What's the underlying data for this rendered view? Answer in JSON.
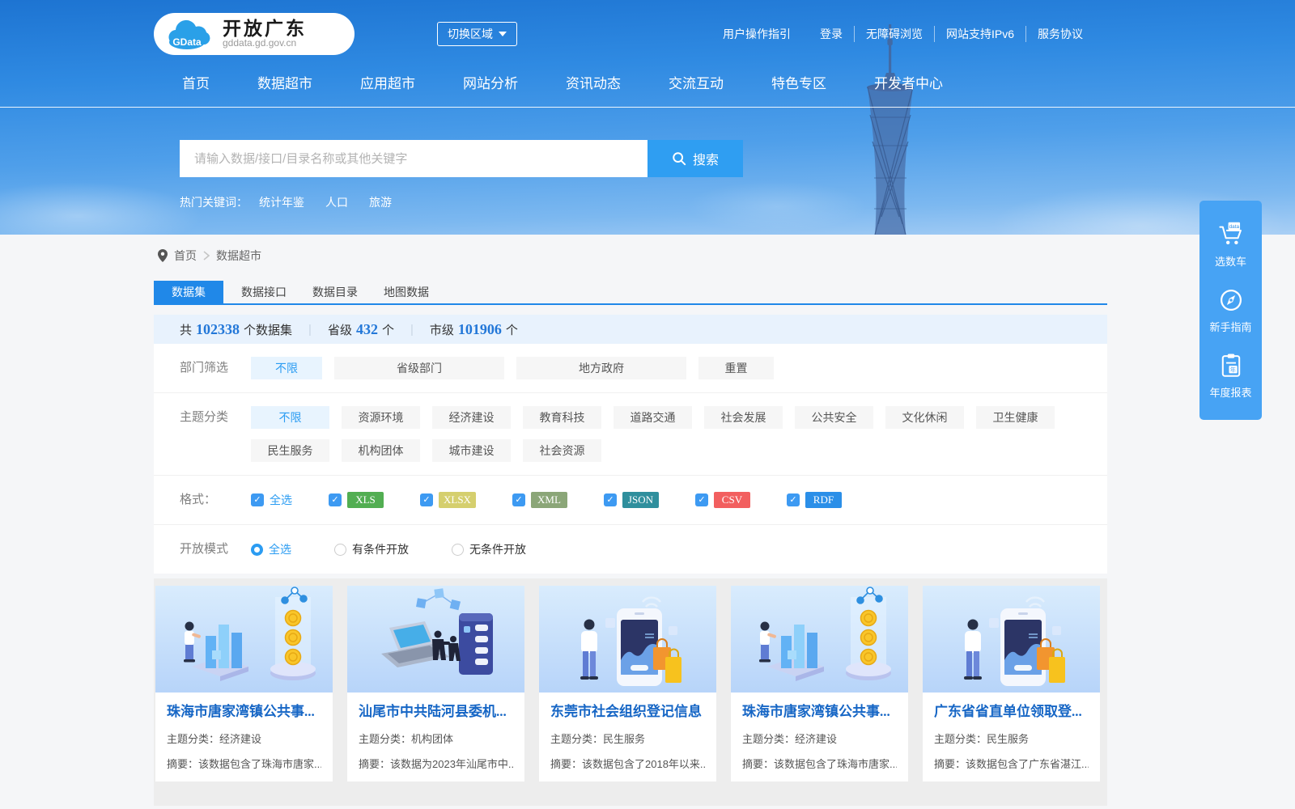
{
  "header": {
    "logo": {
      "badge": "GData",
      "title": "开放广东",
      "domain": "gddata.gd.gov.cn"
    },
    "region_switch_label": "切换区域",
    "top_links": [
      "用户操作指引",
      "登录",
      "无障碍浏览",
      "网站支持IPv6",
      "服务协议"
    ],
    "nav_items": [
      "首页",
      "数据超市",
      "应用超市",
      "网站分析",
      "资讯动态",
      "交流互动",
      "特色专区",
      "开发者中心"
    ]
  },
  "search": {
    "placeholder": "请输入数据/接口/目录名称或其他关键字",
    "button_label": "搜索",
    "hot_label": "热门关键词：",
    "hot_keywords": [
      "统计年鉴",
      "人口",
      "旅游"
    ]
  },
  "side_panel": {
    "items": [
      {
        "icon": "cart-data-icon",
        "label": "选数车"
      },
      {
        "icon": "compass-icon",
        "label": "新手指南"
      },
      {
        "icon": "annual-report-icon",
        "label": "年度报表"
      }
    ]
  },
  "breadcrumb": {
    "home": "首页",
    "current": "数据超市"
  },
  "tabs": [
    "数据集",
    "数据接口",
    "数据目录",
    "地图数据"
  ],
  "stats": {
    "total_prefix": "共",
    "total": "102338",
    "total_suffix": "个数据集",
    "province_label": "省级",
    "province": "432",
    "city_label": "市级",
    "city": "101906",
    "unit": "个"
  },
  "filters": {
    "department": {
      "label": "部门筛选",
      "active": "不限",
      "options": [
        "不限",
        "省级部门",
        "地方政府",
        "重置"
      ]
    },
    "theme": {
      "label": "主题分类",
      "active": "不限",
      "options": [
        "不限",
        "资源环境",
        "经济建设",
        "教育科技",
        "道路交通",
        "社会发展",
        "公共安全",
        "文化休闲",
        "卫生健康",
        "民生服务",
        "机构团体",
        "城市建设",
        "社会资源"
      ]
    },
    "format": {
      "label": "格式：",
      "select_all": "全选",
      "all_checked": true,
      "options": [
        {
          "label": "XLS",
          "color": "#52ae52"
        },
        {
          "label": "XLSX",
          "color": "#d5cf6e"
        },
        {
          "label": "XML",
          "color": "#8ba678"
        },
        {
          "label": "JSON",
          "color": "#2f8f9d"
        },
        {
          "label": "CSV",
          "color": "#f25f5f"
        },
        {
          "label": "RDF",
          "color": "#2b8fe8"
        }
      ]
    },
    "open_mode": {
      "label": "开放模式",
      "selected": "全选",
      "options": [
        "全选",
        "有条件开放",
        "无条件开放"
      ]
    }
  },
  "card_labels": {
    "category": "主题分类：",
    "summary": "摘要："
  },
  "cards": [
    {
      "title": "珠海市唐家湾镇公共事...",
      "category": "经济建设",
      "summary": "该数据包含了珠海市唐家...",
      "illustration": "bars-coins"
    },
    {
      "title": "汕尾市中共陆河县委机...",
      "category": "机构团体",
      "summary": "该数据为2023年汕尾市中...",
      "illustration": "laptop-server"
    },
    {
      "title": "东莞市社会组织登记信息",
      "category": "民生服务",
      "summary": "该数据包含了2018年以来...",
      "illustration": "phone-shopping"
    },
    {
      "title": "珠海市唐家湾镇公共事...",
      "category": "经济建设",
      "summary": "该数据包含了珠海市唐家...",
      "illustration": "bars-coins"
    },
    {
      "title": "广东省省直单位领取登...",
      "category": "民生服务",
      "summary": "该数据包含了广东省湛江...",
      "illustration": "phone-shopping"
    }
  ],
  "colors": {
    "accent": "#2088e8",
    "header_blue": "#2f8ae2",
    "search_button": "#2f9ef2",
    "checkbox": "#3d9af2",
    "side_panel": "#47a3f4"
  }
}
